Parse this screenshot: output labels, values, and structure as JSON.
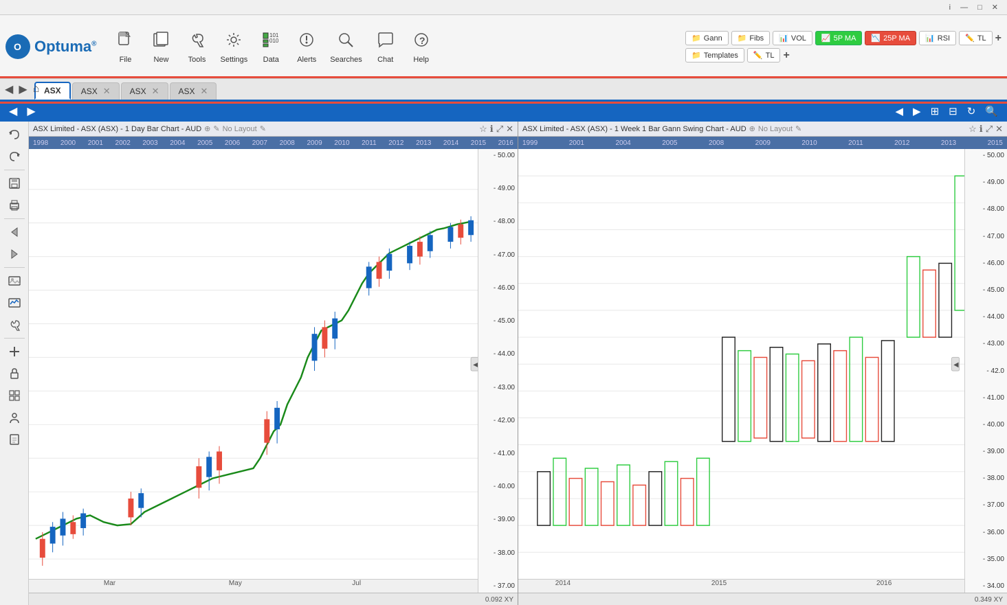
{
  "titlebar": {
    "info_btn": "i",
    "minimize_btn": "—",
    "maximize_btn": "□",
    "close_btn": "✕"
  },
  "toolbar": {
    "logo_text": "Optuma",
    "logo_reg": "®",
    "file_label": "File",
    "new_label": "New",
    "tools_label": "Tools",
    "settings_label": "Settings",
    "data_label": "Data",
    "alerts_label": "Alerts",
    "searches_label": "Searches",
    "chat_label": "Chat",
    "help_label": "Help"
  },
  "right_toolbar": {
    "row1": {
      "gann_label": "Gann",
      "fibs_label": "Fibs",
      "vol_label": "VOL",
      "ma5_label": "5P MA",
      "ma25_label": "25P MA",
      "rsi_label": "RSI",
      "tl_label": "TL",
      "plus_label": "+"
    },
    "row2": {
      "templates_label": "Templates",
      "tl_label": "TL",
      "plus_label": "+"
    }
  },
  "tabs": {
    "items": [
      {
        "label": "ASX",
        "active": true,
        "closable": false
      },
      {
        "label": "ASX",
        "active": false,
        "closable": true
      },
      {
        "label": "ASX",
        "active": false,
        "closable": true
      },
      {
        "label": "ASX",
        "active": false,
        "closable": true
      }
    ]
  },
  "navbar": {
    "back_btn": "◀",
    "forward_btn": "▶",
    "home_btn": "⌂"
  },
  "left_chart": {
    "title": "ASX Limited - ASX (ASX) - 1 Day Bar Chart - AUD",
    "layout": "No Layout",
    "timeline_labels": [
      "1998",
      "2000",
      "2001",
      "2002",
      "2003",
      "2004",
      "2005",
      "2006",
      "2007",
      "2008",
      "2009",
      "2010",
      "2011",
      "2012",
      "2013",
      "2014",
      "2015",
      "2016"
    ],
    "price_labels": [
      "50.00",
      "49.00",
      "48.00",
      "47.00",
      "46.00",
      "45.00",
      "44.00",
      "43.00",
      "42.00",
      "41.00",
      "40.00",
      "39.00",
      "38.00",
      "37.00"
    ],
    "x_labels": [
      {
        "text": "Mar",
        "pct": 18
      },
      {
        "text": "May",
        "pct": 46
      },
      {
        "text": "Jul",
        "pct": 73
      }
    ],
    "bottom_coord": "0.092 XY"
  },
  "right_chart": {
    "title": "ASX Limited - ASX (ASX) - 1 Week 1 Bar Gann Swing Chart - AUD",
    "layout": "No Layout",
    "timeline_labels": [
      "1999",
      "2001",
      "2004",
      "2005",
      "2008",
      "2009",
      "2010",
      "2011",
      "2012",
      "2013",
      "2015"
    ],
    "price_labels": [
      "50.00",
      "49.00",
      "48.00",
      "47.00",
      "46.00",
      "45.00",
      "44.00",
      "43.00",
      "42.00",
      "41.00",
      "40.00",
      "39.00",
      "38.00",
      "37.00",
      "36.00",
      "35.00",
      "34.00"
    ],
    "x_labels": [
      {
        "text": "2014",
        "pct": 10
      },
      {
        "text": "2015",
        "pct": 45
      },
      {
        "text": "2016",
        "pct": 82
      }
    ],
    "bottom_coord": "0.349 XY"
  },
  "sidebar_buttons": [
    "↩",
    "↪",
    "💾",
    "🖨",
    "↩",
    "↪",
    "🖼",
    "📊",
    "🔧",
    "➕",
    "🔒",
    "⊞",
    "👤",
    "📋"
  ],
  "colors": {
    "accent_blue": "#1565c0",
    "toolbar_bg": "#f5f5f5",
    "tab_active_border": "#1565c0",
    "green_ma": "#1a8a1a",
    "candle_up": "#1565c0",
    "candle_down": "#e74c3c",
    "gann_bar_black": "#222",
    "gann_bar_green": "#2ecc40",
    "gann_bar_red": "#e74c3c"
  }
}
